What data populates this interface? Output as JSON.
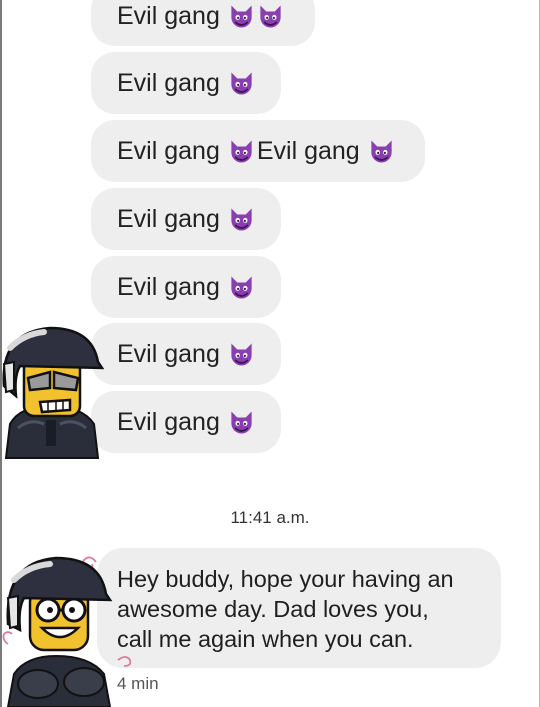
{
  "colors": {
    "bubble": "#eeeeee",
    "emoji_purple": "#8a3fb0",
    "avatar_yellow": "#f2c12e"
  },
  "icons": {
    "emoji": "smiling-imp-icon",
    "avatar_top": "avatar-angry-sunglasses-icon",
    "avatar_bottom": "avatar-happy-glasses-icon"
  },
  "messages": [
    {
      "text": "Evil gang",
      "text2": ""
    },
    {
      "text": "Evil gang",
      "text2": ""
    },
    {
      "text": "Evil gang",
      "text2": "Evil gang"
    },
    {
      "text": "Evil gang",
      "text2": ""
    },
    {
      "text": "Evil gang",
      "text2": ""
    },
    {
      "text": "Evil gang",
      "text2": ""
    },
    {
      "text": "Evil gang",
      "text2": ""
    }
  ],
  "timestamp": "11:41 a.m.",
  "dad_message": {
    "lines": [
      "Hey buddy, hope your having an",
      "awesome day. Dad loves you,",
      "call me again when you can."
    ],
    "sent_ago": "4 min"
  }
}
